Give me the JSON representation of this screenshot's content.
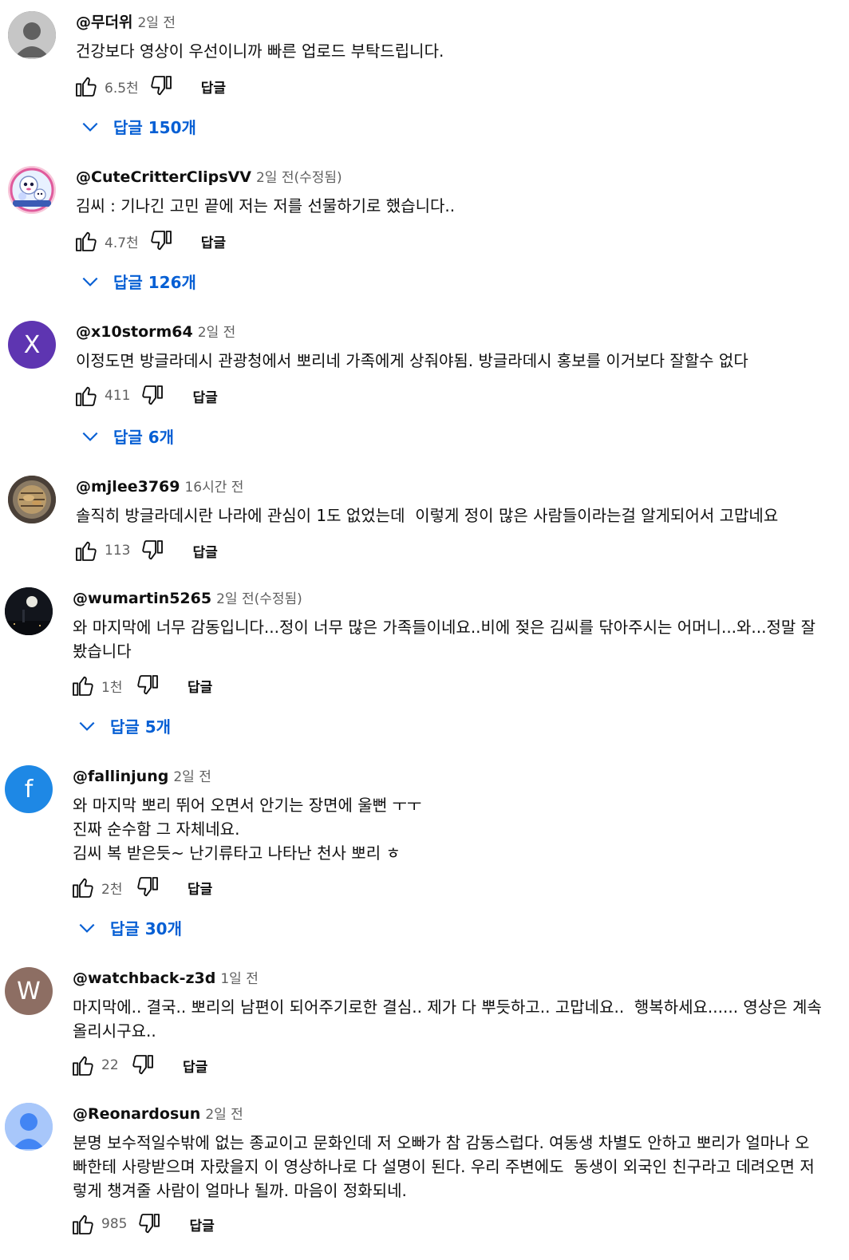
{
  "ui": {
    "reply_label": "답글"
  },
  "colors": {
    "link_blue": "#065fd4",
    "meta_gray": "#606060"
  },
  "comments": [
    {
      "handle": "@무더위",
      "time": "2일 전",
      "avatar": {
        "type": "default-person-icon",
        "bg": "#606060"
      },
      "text": [
        "건강보다 영상이 우선이니까 빠른 업로드 부탁드립니다."
      ],
      "likes": "6.5천",
      "replies": "답글 150개"
    },
    {
      "handle": "@CuteCritterClipsVV",
      "time": "2일 전(수정됨)",
      "avatar": {
        "type": "image-icon",
        "bg": "#f7c6d9",
        "caption": "critterClip"
      },
      "text": [
        "김씨 : 기나긴 고민 끝에 저는 저를 선물하기로 했습니다.."
      ],
      "likes": "4.7천",
      "replies": "답글 126개"
    },
    {
      "handle": "@x10storm64",
      "time": "2일 전",
      "avatar": {
        "type": "letter",
        "letter": "X",
        "bg": "#5e35b1"
      },
      "text": [
        "이정도면 방글라데시 관광청에서 뽀리네 가족에게 상줘야됨. 방글라데시 홍보를 이거보다 잘할수 없다"
      ],
      "likes": "411",
      "replies": "답글 6개"
    },
    {
      "handle": "@mjlee3769",
      "time": "16시간 전",
      "avatar": {
        "type": "image-icon",
        "bg": "#6b5a46"
      },
      "text": [
        "솔직히 방글라데시란 나라에 관심이 1도 없었는데  이렇게 정이 많은 사람들이라는걸 알게되어서 고맙네요"
      ],
      "likes": "113",
      "replies": ""
    },
    {
      "handle": "@wumartin5265",
      "time": "2일 전(수정됨)",
      "avatar": {
        "type": "image-icon",
        "bg": "#1a1d24"
      },
      "text": [
        "와 마지막에 너무 감동입니다...정이 너무 많은 가족들이네요..비에 젖은 김씨를 닦아주시는 어머니...와...정말 잘",
        "봤습니다"
      ],
      "likes": "1천",
      "replies": "답글 5개"
    },
    {
      "handle": "@fallinjung",
      "time": "2일 전",
      "avatar": {
        "type": "letter",
        "letter": "f",
        "bg": "#1e88e5"
      },
      "text": [
        "와 마지막 뽀리 뛰어 오면서 안기는 장면에 울뻔 ㅜㅜ",
        "진짜 순수함 그 자체네요.",
        "김씨 복 받은듯~ 난기류타고 나타난 천사 뽀리 ㅎ"
      ],
      "likes": "2천",
      "replies": "답글 30개"
    },
    {
      "handle": "@watchback-z3d",
      "time": "1일 전",
      "avatar": {
        "type": "letter",
        "letter": "W",
        "bg": "#8d6e63"
      },
      "text": [
        "마지막에.. 결국.. 뽀리의 남편이 되어주기로한 결심.. 제가 다 뿌듯하고.. 고맙네요..  행복하세요...... 영상은 계속",
        "올리시구요.."
      ],
      "likes": "22",
      "replies": ""
    },
    {
      "handle": "@Reonardosun",
      "time": "2일 전",
      "avatar": {
        "type": "default-person-icon",
        "bg": "#a8c7fa",
        "fg": "#4285f4"
      },
      "text": [
        "분명 보수적일수밖에 없는 종교이고 문화인데 저 오빠가 참 감동스럽다. 여동생 차별도 안하고 뽀리가 얼마나 오",
        "빠한테 사랑받으며 자랐을지 이 영상하나로 다 설명이 된다. 우리 주변에도  동생이 외국인 친구라고 데려오면 저",
        "렇게 챙겨줄 사람이 얼마나 될까. 마음이 정화되네."
      ],
      "likes": "985",
      "replies": ""
    }
  ]
}
